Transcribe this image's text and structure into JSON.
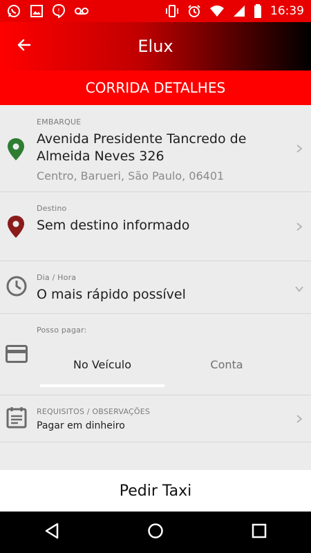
{
  "status_bar": {
    "time": "16:39",
    "icons": [
      "whatsapp-icon",
      "image-icon",
      "hangouts-icon",
      "voicemail-icon",
      "vibrate-icon",
      "alarm-icon",
      "wifi-icon",
      "signal-icon",
      "battery-icon"
    ]
  },
  "app_bar": {
    "title": "Elux",
    "back_icon": "arrow-left-icon"
  },
  "sub_header": {
    "title": "CORRIDA DETALHES"
  },
  "embarque": {
    "label": "EMBARQUE",
    "address_line1": "Avenida Presidente Tancredo de",
    "address_line2": "Almeida Neves 326",
    "locality": "Centro, Barueri, São Paulo, 06401",
    "icon": "map-pin-icon",
    "icon_color": "#2e7d32"
  },
  "destino": {
    "label": "Destino",
    "value": "Sem destino informado",
    "icon": "map-pin-icon",
    "icon_color": "#8b1a1a"
  },
  "dia_hora": {
    "label": "Dia / Hora",
    "value": "O mais rápido possível",
    "icon": "clock-icon"
  },
  "pagamento": {
    "label": "Posso pagar:",
    "icon": "credit-card-icon",
    "options": [
      "No Veículo",
      "Conta"
    ],
    "selected": "No Veículo"
  },
  "requisitos": {
    "label": "REQUISITOS / OBSERVAÇÕES",
    "value": "Pagar em dinheiro",
    "icon": "notes-icon"
  },
  "action": {
    "label": "Pedir Taxi"
  },
  "theme": {
    "primary": "#ff0000",
    "status_bar": "#e80000"
  }
}
